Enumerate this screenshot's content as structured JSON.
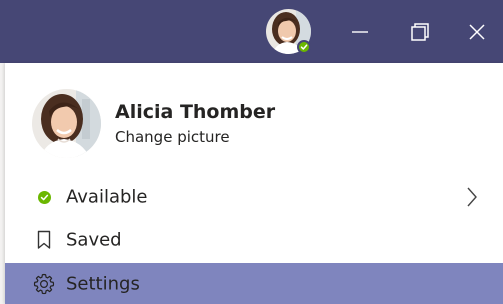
{
  "titlebar": {
    "avatar_alt": "Alicia Thomber avatar",
    "presence": "available",
    "buttons": {
      "minimize_icon": "minimize-icon",
      "maximize_icon": "restore-icon",
      "close_icon": "close-icon"
    }
  },
  "profile": {
    "name": "Alicia Thomber",
    "change_picture": "Change picture"
  },
  "menu": {
    "items": [
      {
        "label": "Available",
        "icon": "status-available-icon",
        "has_submenu": true
      },
      {
        "label": "Saved",
        "icon": "bookmark-icon",
        "has_submenu": false
      },
      {
        "label": "Settings",
        "icon": "gear-icon",
        "has_submenu": false,
        "highlighted": true
      }
    ]
  },
  "colors": {
    "titlebar": "#464775",
    "highlight": "#7f85be",
    "presence_green": "#6bb700",
    "text": "#252423"
  }
}
